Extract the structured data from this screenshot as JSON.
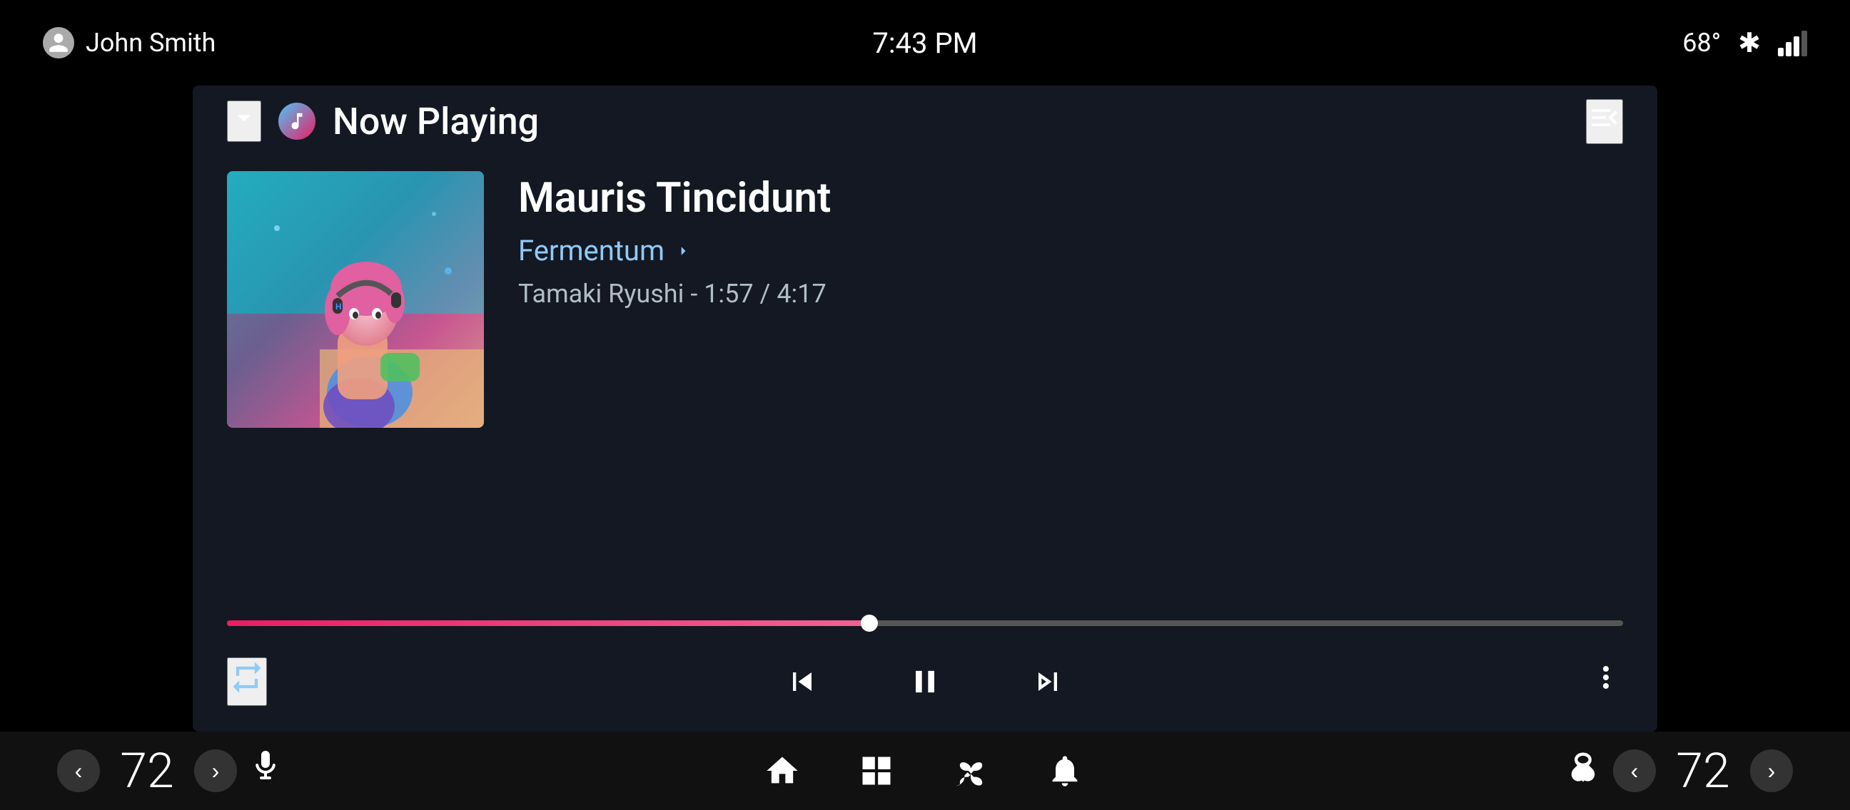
{
  "statusBar": {
    "user": "John Smith",
    "time": "7:43 PM",
    "temperature": "68°"
  },
  "header": {
    "nowPlaying": "Now Playing",
    "chevronLabel": "▾"
  },
  "song": {
    "title": "Mauris Tincidunt",
    "album": "Fermentum",
    "artist": "Tamaki Ryushi",
    "currentTime": "1:57",
    "totalTime": "4:17",
    "artistTime": "Tamaki Ryushi - 1:57 / 4:17",
    "progressPercent": 46
  },
  "controls": {
    "repeatLabel": "⇄",
    "prevLabel": "⏮",
    "pauseLabel": "⏸",
    "nextLabel": "⏭",
    "moreLabel": "⋮"
  },
  "bottomNav": {
    "leftTemp": "72",
    "rightTemp": "72",
    "leftTempDecLabel": "‹",
    "leftTempIncLabel": "›",
    "rightTempDecLabel": "‹",
    "rightTempIncLabel": "›",
    "micIcon": "mic",
    "homeIcon": "home",
    "gridIcon": "grid",
    "fanIcon": "fan",
    "bellIcon": "bell",
    "ventIcon": "vent"
  }
}
